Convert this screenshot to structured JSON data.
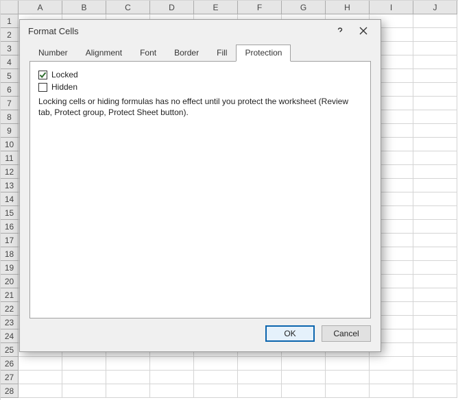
{
  "spreadsheet": {
    "columns": [
      "A",
      "B",
      "C",
      "D",
      "E",
      "F",
      "G",
      "H",
      "I",
      "J"
    ],
    "row_count": 28
  },
  "dialog": {
    "title": "Format Cells",
    "tabs": [
      {
        "label": "Number"
      },
      {
        "label": "Alignment"
      },
      {
        "label": "Font"
      },
      {
        "label": "Border"
      },
      {
        "label": "Fill"
      },
      {
        "label": "Protection"
      }
    ],
    "active_tab": "Protection",
    "protection": {
      "locked_checked": true,
      "locked_label": "Locked",
      "hidden_checked": false,
      "hidden_label": "Hidden",
      "help_text": "Locking cells or hiding formulas has no effect until you protect the worksheet (Review tab, Protect group, Protect Sheet button)."
    },
    "buttons": {
      "ok": "OK",
      "cancel": "Cancel"
    }
  }
}
